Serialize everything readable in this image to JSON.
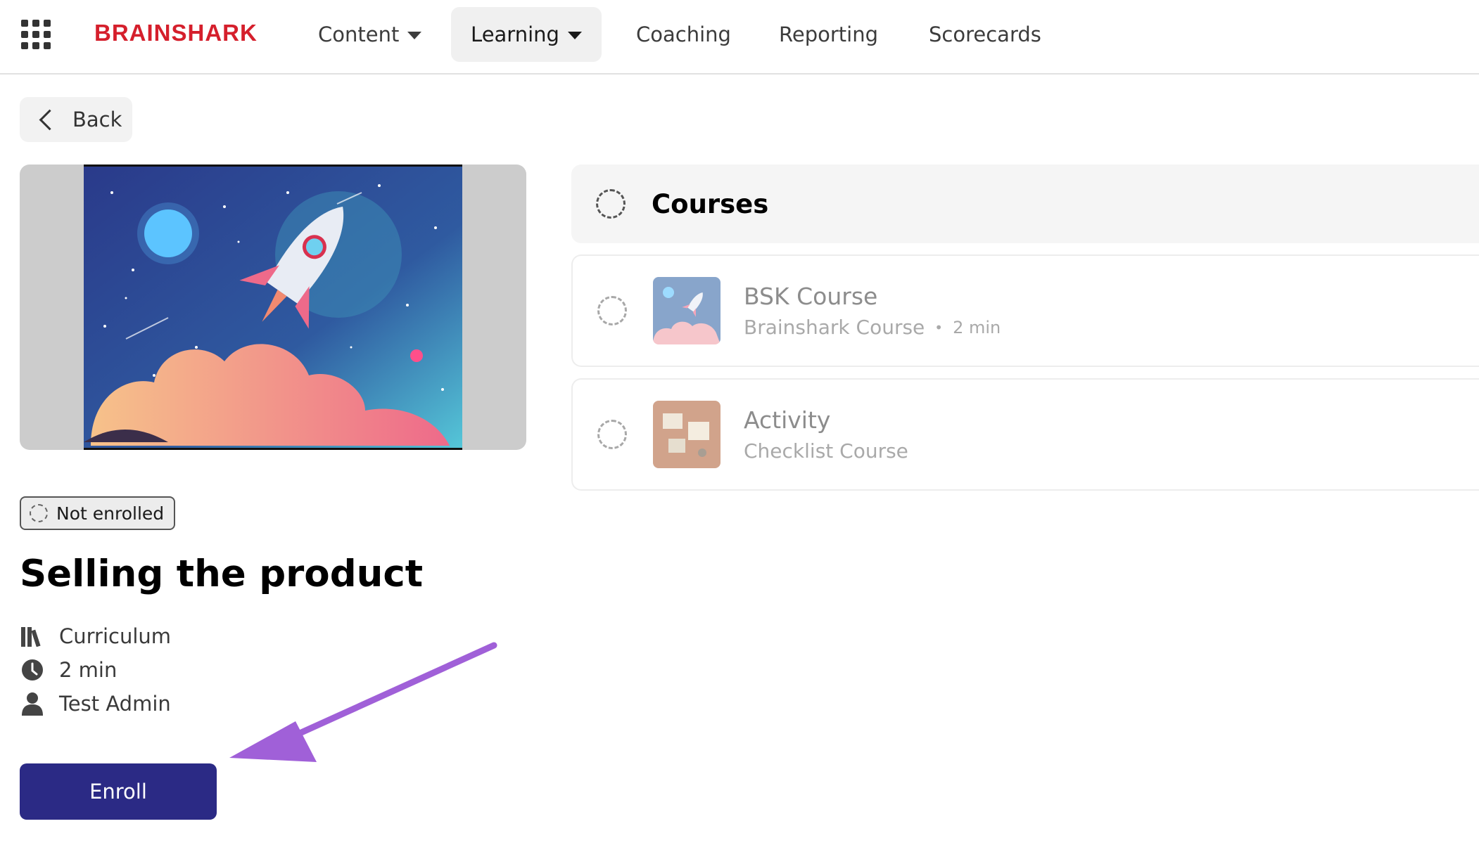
{
  "brand": {
    "name": "BRAINSHARK",
    "color": "#d51f2c"
  },
  "nav": {
    "app_launcher_icon": "grid-icon",
    "items": [
      {
        "label": "Content",
        "has_dropdown": true
      },
      {
        "label": "Learning",
        "has_dropdown": true,
        "active": true
      },
      {
        "label": "Coaching"
      },
      {
        "label": "Reporting"
      },
      {
        "label": "Scorecards"
      }
    ]
  },
  "back": {
    "label": "Back",
    "icon": "chevron-left-icon"
  },
  "curriculum": {
    "status": "Not enrolled",
    "title": "Selling the product",
    "type": "Curriculum",
    "duration": "2 min",
    "author": "Test Admin",
    "enroll_label": "Enroll"
  },
  "courses": {
    "heading": "Courses",
    "items": [
      {
        "name": "BSK Course",
        "subtitle": "Brainshark Course",
        "separator": "•",
        "duration": "2 min"
      },
      {
        "name": "Activity",
        "subtitle": "Checklist Course"
      }
    ]
  },
  "colors": {
    "primary_button": "#2b2a85",
    "annotation_arrow": "#a060d8"
  }
}
